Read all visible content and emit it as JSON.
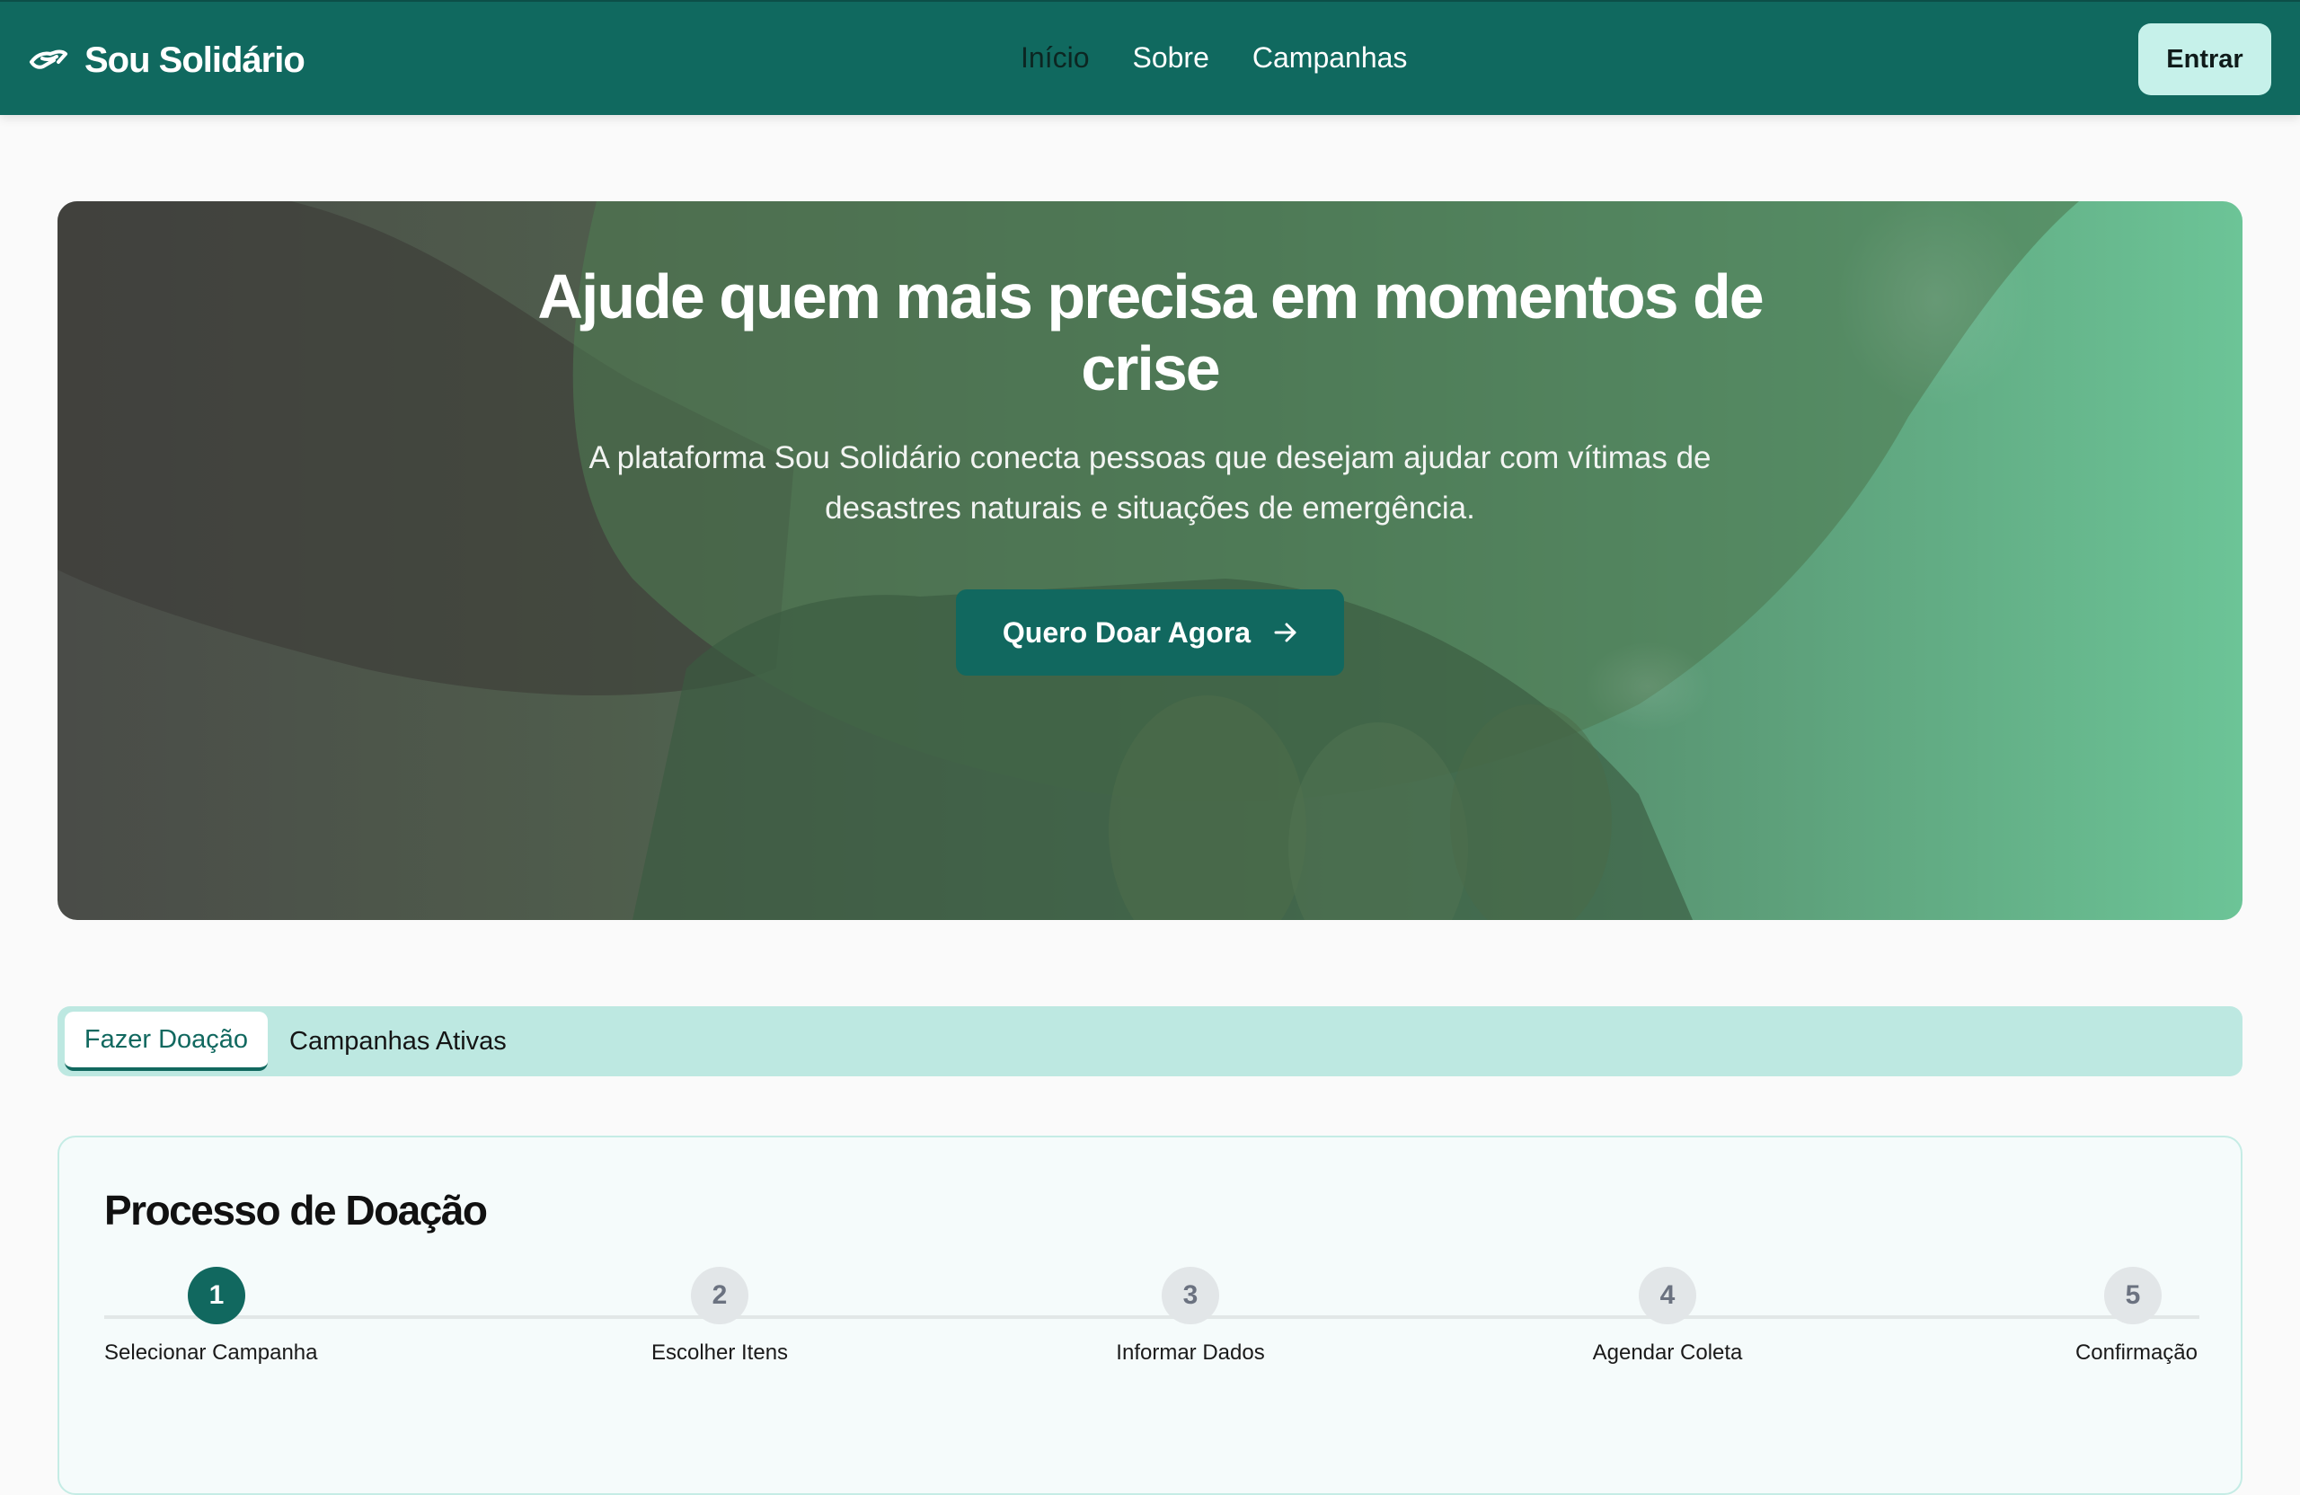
{
  "header": {
    "brand": "Sou Solidário",
    "nav": [
      {
        "label": "Início",
        "active": true
      },
      {
        "label": "Sobre",
        "active": false
      },
      {
        "label": "Campanhas",
        "active": false
      }
    ],
    "login_label": "Entrar"
  },
  "hero": {
    "title_line1": "Ajude quem mais precisa em momentos de",
    "title_line2": "crise",
    "subtitle_line1": "A plataforma Sou Solidário conecta pessoas que desejam ajudar com vítimas de",
    "subtitle_line2": "desastres naturais e situações de emergência.",
    "cta_label": "Quero Doar Agora",
    "cta_icon": "arrow-right-icon"
  },
  "tabs": {
    "items": [
      {
        "label": "Fazer Doação",
        "active": true
      },
      {
        "label": "Campanhas Ativas",
        "active": false
      }
    ]
  },
  "process": {
    "title": "Processo de Doação",
    "current_step": 1,
    "steps": [
      {
        "number": "1",
        "label": "Selecionar Campanha"
      },
      {
        "number": "2",
        "label": "Escolher Itens"
      },
      {
        "number": "3",
        "label": "Informar Dados"
      },
      {
        "number": "4",
        "label": "Agendar Coleta"
      },
      {
        "number": "5",
        "label": "Confirmação"
      }
    ]
  },
  "colors": {
    "primary": "#11685f",
    "header_bg": "#10695f",
    "login_bg": "#c6f1ea",
    "tabs_bg": "#bde8e1",
    "card_bg": "#f5fbfb"
  }
}
